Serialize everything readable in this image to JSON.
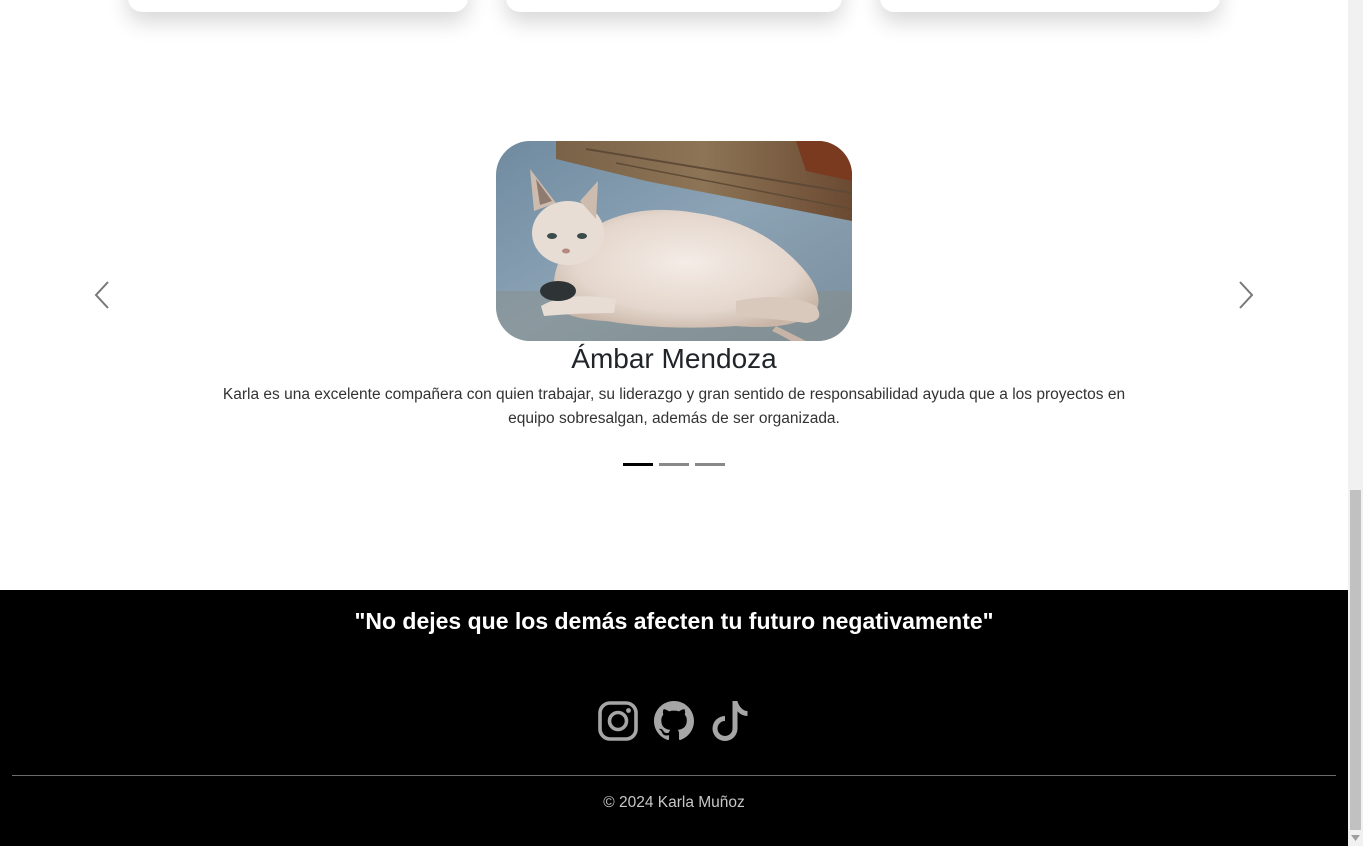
{
  "carousel": {
    "slide": {
      "image_alt": "Gato blanco con manchas recostado sobre el piso",
      "name": "Ámbar Mendoza",
      "text": "Karla es una excelente compañera con quien trabajar, su liderazgo y gran sentido de responsabilidad ayuda que a los proyectos en equipo sobresalgan, además de ser organizada."
    },
    "prev_icon": "chevron-left-icon",
    "next_icon": "chevron-right-icon",
    "indicators": [
      {
        "active": true
      },
      {
        "active": false
      },
      {
        "active": false
      }
    ]
  },
  "footer": {
    "quote": "\"No dejes que los demás afecten tu futuro negativamente\"",
    "social_links": [
      {
        "icon": "instagram-icon"
      },
      {
        "icon": "github-icon"
      },
      {
        "icon": "tiktok-icon"
      }
    ],
    "icon_color": "#a6a6a6",
    "copyright": "© 2024 Karla Muñoz"
  },
  "colors": {
    "footer_bg": "#000000",
    "indicator_active": "#000000",
    "indicator_inactive": "#888888"
  }
}
